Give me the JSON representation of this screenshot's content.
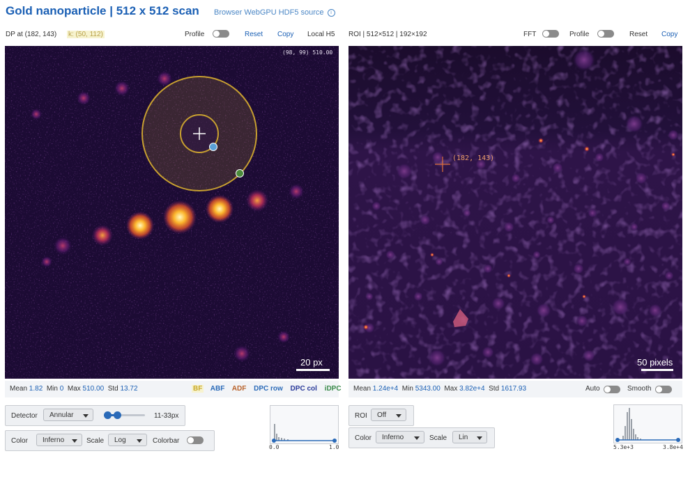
{
  "header": {
    "title": "Gold nanoparticle | 512 x 512 scan",
    "subtitle": "Browser WebGPU HDF5 source",
    "info_icon": "i"
  },
  "left_bar": {
    "dp_label": "DP at (182, 143)",
    "k_label": "k: (50, 112)",
    "profile_label": "Profile",
    "reset_label": "Reset",
    "copy_label": "Copy",
    "source_label": "Local H5"
  },
  "right_bar": {
    "roi_label": "ROI | 512×512 | 192×192",
    "fft_label": "FFT",
    "profile_label": "Profile",
    "reset_label": "Reset",
    "copy_label": "Copy"
  },
  "left_panel": {
    "cursor_readout": "(98, 99) 510.00",
    "scalebar_label": "20 px"
  },
  "right_panel": {
    "marker_label": "(182, 143)",
    "scalebar_label": "50 pixels"
  },
  "left_stats": {
    "mean_label": "Mean",
    "mean": "1.82",
    "min_label": "Min",
    "min": "0",
    "max_label": "Max",
    "max": "510.00",
    "std_label": "Std",
    "std": "13.72"
  },
  "detector_modes": [
    {
      "label": "BF",
      "color": "#c8a82a"
    },
    {
      "label": "ABF",
      "color": "#2a6ab8"
    },
    {
      "label": "ADF",
      "color": "#b8622a"
    },
    {
      "label": "DPC row",
      "color": "#2a6ab8"
    },
    {
      "label": "DPC col",
      "color": "#2a3a9a"
    },
    {
      "label": "iDPC",
      "color": "#3a8a4a"
    }
  ],
  "right_stats": {
    "mean_label": "Mean",
    "mean": "1.24e+4",
    "min_label": "Min",
    "min": "5343.00",
    "max_label": "Max",
    "max": "3.82e+4",
    "std_label": "Std",
    "std": "1617.93",
    "auto_label": "Auto",
    "smooth_label": "Smooth"
  },
  "left_controls": {
    "detector_label": "Detector",
    "detector_value": "Annular",
    "range_label": "11-33px",
    "color_label": "Color",
    "color_value": "Inferno",
    "scale_label": "Scale",
    "scale_value": "Log",
    "colorbar_label": "Colorbar",
    "hist_min": "0.0",
    "hist_max": "1.0"
  },
  "right_controls": {
    "roi_label": "ROI",
    "roi_value": "Off",
    "color_label": "Color",
    "color_value": "Inferno",
    "scale_label": "Scale",
    "scale_value": "Lin",
    "hist_min": "5.3e+3",
    "hist_max": "3.8e+4"
  },
  "colors": {
    "accent": "#1a5fb4",
    "inferno_dark": "#1b0c2e",
    "ring": "#c8a030"
  }
}
